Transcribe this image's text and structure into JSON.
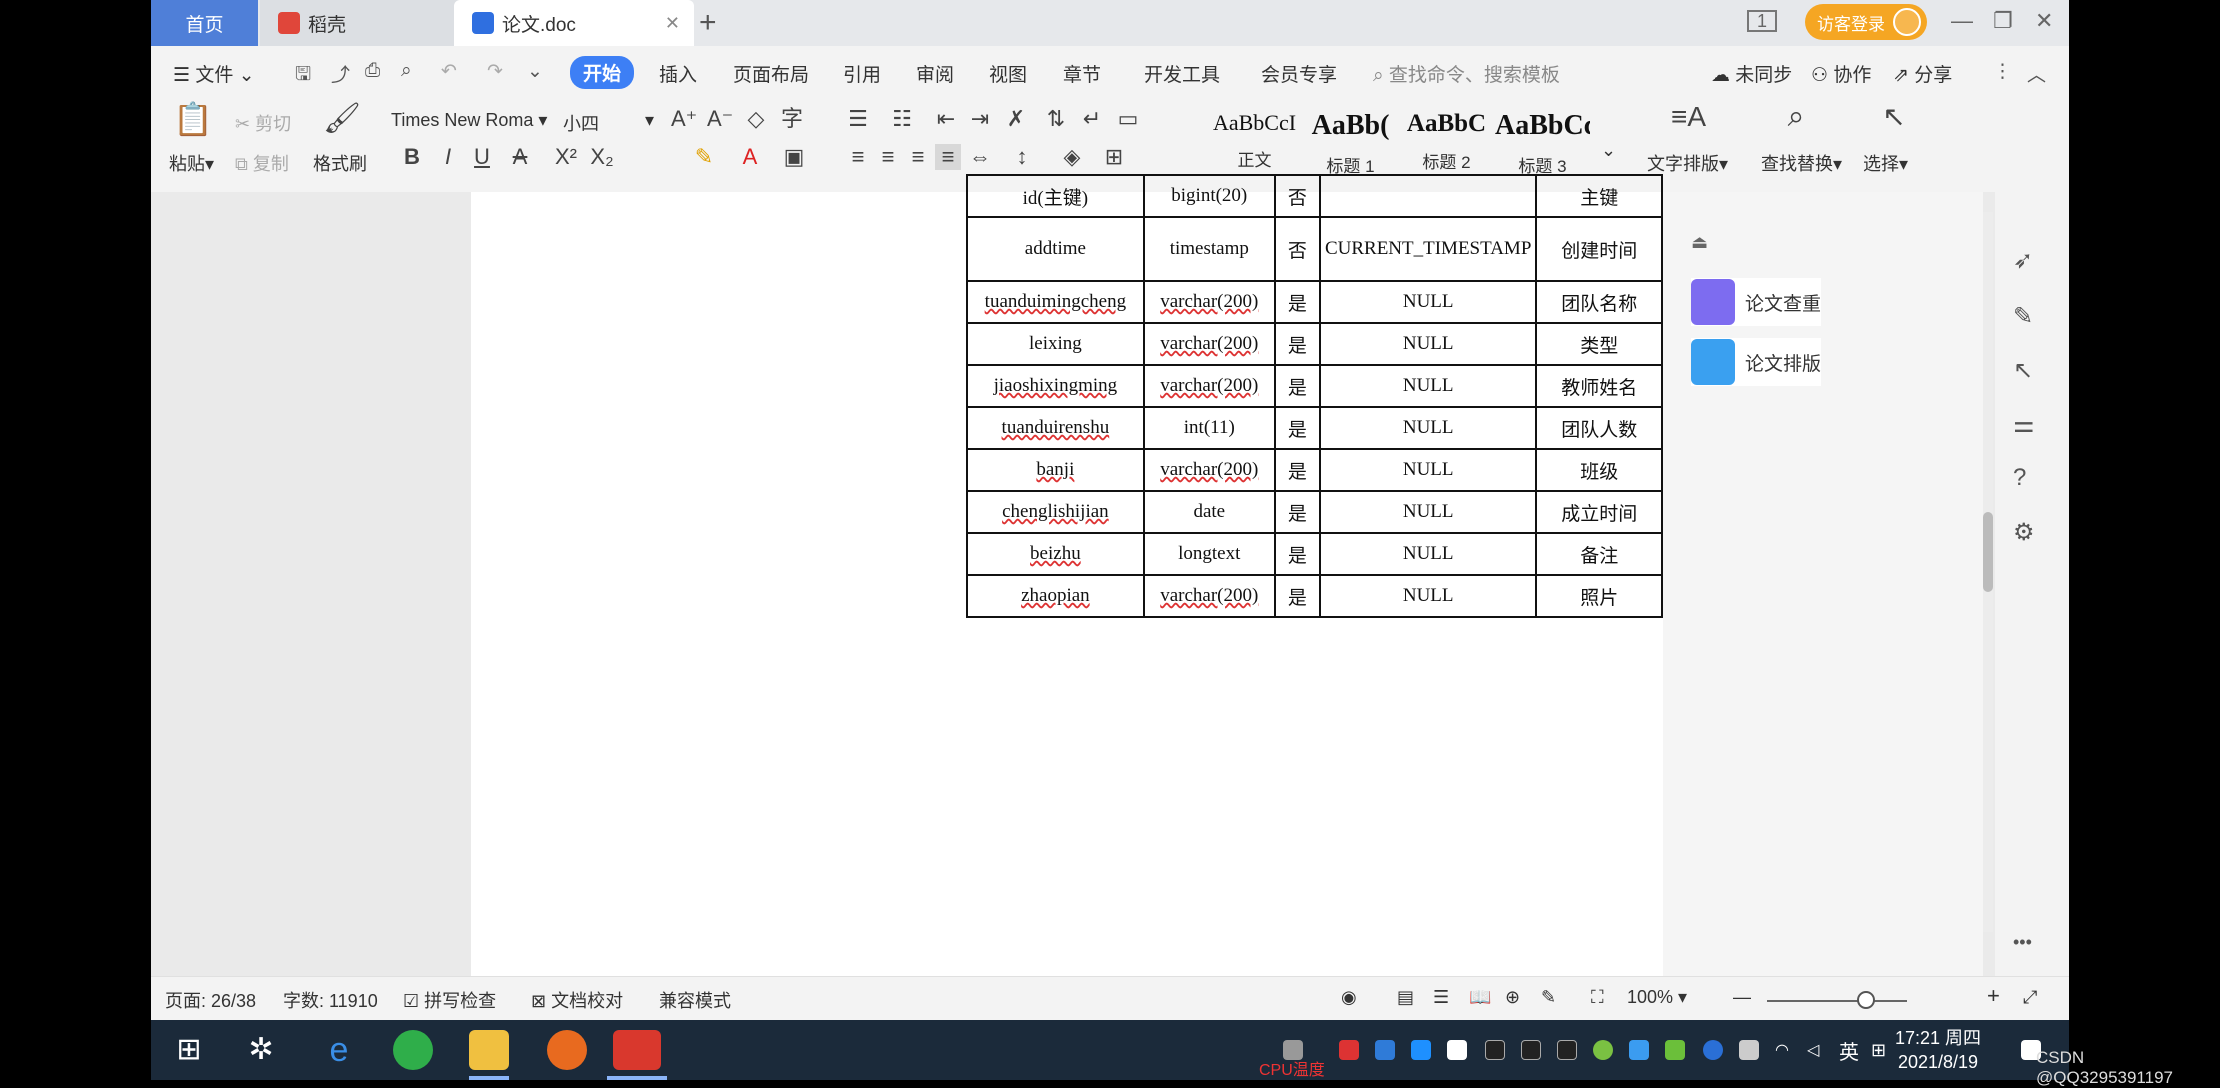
{
  "tabs": {
    "home": "首页",
    "daoke": "稻壳",
    "doc": "论文.doc",
    "login": "访客登录",
    "page_indicator": "1"
  },
  "menu": {
    "file": "文件",
    "items": [
      "开始",
      "插入",
      "页面布局",
      "引用",
      "审阅",
      "视图",
      "章节",
      "开发工具",
      "会员专享"
    ],
    "search_placeholder": "查找命令、搜索模板",
    "sync": "未同步",
    "collab": "协作",
    "share": "分享"
  },
  "ribbon": {
    "paste": "粘贴",
    "cut": "剪切",
    "copy": "复制",
    "format_painter": "格式刷",
    "font_name": "Times New Roma",
    "font_size": "小四",
    "styles": [
      {
        "preview": "AaBbCcI",
        "name": "正文",
        "bold": false
      },
      {
        "preview": "AaBb(",
        "name": "标题 1",
        "bold": true
      },
      {
        "preview": "AaBbC",
        "name": "标题 2",
        "bold": true
      },
      {
        "preview": "AaBbCcl",
        "name": "标题 3",
        "bold": true
      }
    ],
    "text_layout": "文字排版",
    "find_replace": "查找替换",
    "select": "选择"
  },
  "table": {
    "partial_row": [
      "id(主键)",
      "bigint(20)",
      "否",
      "",
      "主键"
    ],
    "rows": [
      [
        "addtime",
        "timestamp",
        "否",
        "CURRENT_TIMESTAMP",
        "创建时间"
      ],
      [
        "tuanduimingcheng",
        "varchar(200)",
        "是",
        "NULL",
        "团队名称"
      ],
      [
        "leixing",
        "varchar(200)",
        "是",
        "NULL",
        "类型"
      ],
      [
        "jiaoshixingming",
        "varchar(200)",
        "是",
        "NULL",
        "教师姓名"
      ],
      [
        "tuanduirenshu",
        "int(11)",
        "是",
        "NULL",
        "团队人数"
      ],
      [
        "banji",
        "varchar(200)",
        "是",
        "NULL",
        "班级"
      ],
      [
        "chenglishijian",
        "date",
        "是",
        "NULL",
        "成立时间"
      ],
      [
        "beizhu",
        "longtext",
        "是",
        "NULL",
        "备注"
      ],
      [
        "zhaopian",
        "varchar(200)",
        "是",
        "NULL",
        "照片"
      ]
    ]
  },
  "taskpane": {
    "check": "论文查重",
    "format": "论文排版"
  },
  "status": {
    "page": "页面: 26/38",
    "words": "字数: 11910",
    "spell": "拼写检查",
    "proof": "文档校对",
    "compat": "兼容模式",
    "zoom": "100%"
  },
  "taskbar": {
    "time": "17:21 周四",
    "date": "2021/8/19",
    "lang": "英",
    "cpu": "CPU温度",
    "watermark": "CSDN @QQ3295391197"
  }
}
